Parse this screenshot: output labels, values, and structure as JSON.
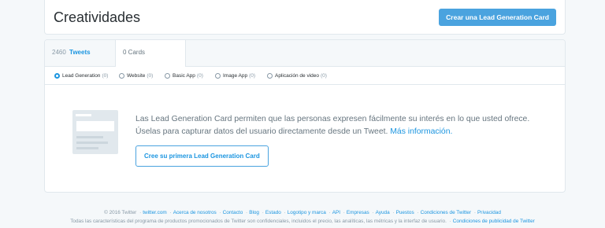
{
  "header": {
    "title": "Creatividades",
    "create_button": "Crear una Lead Generation Card"
  },
  "tabs": [
    {
      "count": "2460",
      "word": "Tweets"
    },
    {
      "count": "0 Cards"
    }
  ],
  "filters": [
    {
      "label": "Lead Generation",
      "count": "(0)",
      "selected": true
    },
    {
      "label": "Website",
      "count": "(0)",
      "selected": false
    },
    {
      "label": "Basic App",
      "count": "(0)",
      "selected": false
    },
    {
      "label": "Image App",
      "count": "(0)",
      "selected": false
    },
    {
      "label": "Aplicación de video",
      "count": "(0)",
      "selected": false
    }
  ],
  "empty_state": {
    "icon": "card-placeholder-icon",
    "line1": "Las Lead Generation Card permiten que las personas expresen fácilmente su interés en lo que usted ofrece.",
    "line2": "Úselas para capturar datos del usuario directamente desde un Tweet.",
    "link": "Más información.",
    "button": "Cree su primera Lead Generation Card"
  },
  "footer": {
    "copyright": "© 2016 Twitter",
    "links": [
      "twitter.com",
      "Acerca de nosotros",
      "Contacto",
      "Blog",
      "Estado",
      "Logotipo y marca",
      "API",
      "Empresas",
      "Ayuda",
      "Puestos",
      "Condiciones de Twitter",
      "Privacidad"
    ],
    "disclaimer": "Todas las características del programa de productos promocionados de Twitter son confidenciales, incluidos el precio, las analíticas, las métricas y la interfaz de usuario.",
    "ads_terms": "Condiciones de publicidad de Twitter"
  },
  "colors": {
    "accent": "#1b95e0",
    "button": "#4aa3df",
    "background": "#f5f8fa"
  }
}
